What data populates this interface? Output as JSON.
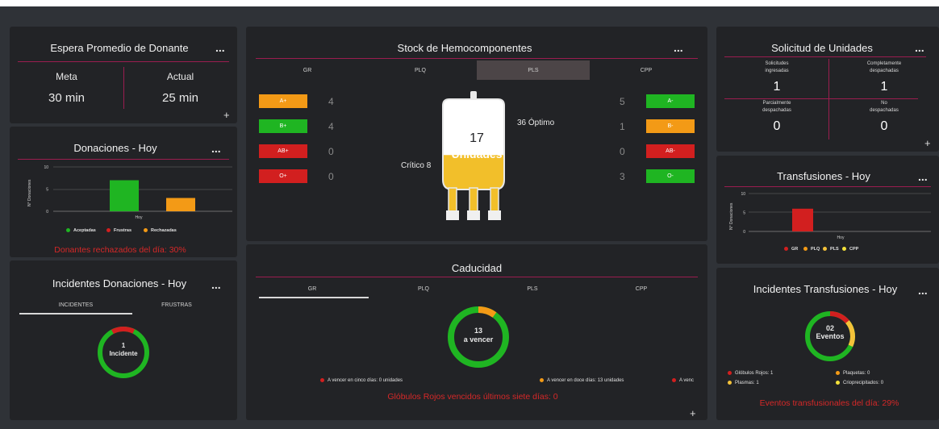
{
  "colors": {
    "green": "#1fb522",
    "orange": "#f39a16",
    "red": "#d21f1f",
    "yellow": "#f4c23a",
    "accent_line": "#9b1d4f",
    "card_bg": "#222326",
    "page_bg": "#2f3237"
  },
  "espera": {
    "title": "Espera Promedio de Donante",
    "menu": "...",
    "meta_label": "Meta",
    "meta_value": "30 min",
    "actual_label": "Actual",
    "actual_value": "25 min",
    "plus": "+"
  },
  "donaciones": {
    "title": "Donaciones - Hoy",
    "menu": "...",
    "ylabel": "N° Donaciones",
    "xlabel": "Hoy",
    "yticks": [
      "10",
      "5",
      "0"
    ],
    "legend": [
      {
        "label": "Aceptadas",
        "color": "#1fb522"
      },
      {
        "label": "Frustras",
        "color": "#d21f1f"
      },
      {
        "label": "Rechazadas",
        "color": "#f39a16"
      }
    ],
    "note": "Donantes rechazados del día: 30%"
  },
  "chart_data": [
    {
      "type": "bar",
      "xlabel": "Hoy",
      "ylabel": "N° Donaciones",
      "ylim": [
        0,
        10
      ],
      "categories": [
        "Hoy"
      ],
      "series": [
        {
          "name": "Aceptadas",
          "values": [
            7
          ]
        },
        {
          "name": "Frustras",
          "values": [
            0
          ]
        },
        {
          "name": "Rechazadas",
          "values": [
            3
          ]
        }
      ]
    },
    {
      "type": "bar",
      "xlabel": "Hoy",
      "ylabel": "N° Donaciones",
      "ylim": [
        0,
        10
      ],
      "categories": [
        "Hoy"
      ],
      "series": [
        {
          "name": "GR",
          "values": [
            6
          ]
        },
        {
          "name": "PLQ",
          "values": [
            0
          ]
        },
        {
          "name": "PLS",
          "values": [
            0
          ]
        },
        {
          "name": "CPP",
          "values": [
            0
          ]
        }
      ]
    },
    {
      "type": "pie",
      "series": [
        {
          "name": "Rechazos",
          "values": [
            0.15
          ]
        },
        {
          "name": "Resto",
          "values": [
            0.85
          ]
        }
      ]
    },
    {
      "type": "pie",
      "series": [
        {
          "name": "A vencer en doce días",
          "values": [
            13
          ]
        },
        {
          "name": "Resto",
          "values": [
            0.1
          ]
        }
      ]
    },
    {
      "type": "pie",
      "series": [
        {
          "name": "Glóbulos Rojos",
          "values": [
            1
          ]
        },
        {
          "name": "Plasmas",
          "values": [
            1
          ]
        }
      ]
    }
  ],
  "incidentes_donaciones": {
    "title": "Incidentes Donaciones - Hoy",
    "menu": "...",
    "tabs": [
      "INCIDENTES",
      "FRUSTRAS"
    ],
    "donut_number": "1",
    "donut_label": "Incidente",
    "ring": {
      "red_fraction": 0.15
    }
  },
  "stock": {
    "title": "Stock de Hemocomponentes",
    "menu": "...",
    "tabs": [
      "GR",
      "PLQ",
      "PLS",
      "CPP"
    ],
    "active_tab": "PLS",
    "left": [
      {
        "label": "A+",
        "count": "4",
        "color": "#f39a16"
      },
      {
        "label": "B+",
        "count": "4",
        "color": "#1fb522"
      },
      {
        "label": "AB+",
        "count": "0",
        "color": "#d21f1f"
      },
      {
        "label": "O+",
        "count": "0",
        "color": "#d21f1f"
      }
    ],
    "right": [
      {
        "label": "A-",
        "count": "5",
        "color": "#1fb522"
      },
      {
        "label": "B-",
        "count": "1",
        "color": "#f39a16"
      },
      {
        "label": "AB-",
        "count": "0",
        "color": "#d21f1f"
      },
      {
        "label": "O-",
        "count": "3",
        "color": "#1fb522"
      }
    ],
    "bag_number": "17",
    "bag_label": "Unidades",
    "optimo_value": "36",
    "optimo_label": "Óptimo",
    "critico_label": "Crítico",
    "critico_value": "8",
    "fill_level": 0.38
  },
  "caducidad": {
    "title": "Caducidad",
    "tabs": [
      "GR",
      "PLQ",
      "PLS",
      "CPP"
    ],
    "donut_number": "13",
    "donut_label": "a vencer",
    "legend": [
      {
        "label": "A vencer en cinco días: 0 unidades",
        "color": "#d21f1f"
      },
      {
        "label": "A vencer en doce días: 13 unidades",
        "color": "#f39a16"
      },
      {
        "label": "A venc",
        "color": "#d21f1f"
      }
    ],
    "note": "Glóbulos Rojos vencidos últimos siete días: 0",
    "plus": "+"
  },
  "solicitud": {
    "title": "Solicitud de Unidades",
    "menu": "...",
    "cells": [
      {
        "line1": "Solicitudes",
        "line2": "ingresadas",
        "value": "1"
      },
      {
        "line1": "Completamente",
        "line2": "despachadas",
        "value": "1"
      },
      {
        "line1": "Parcialmente",
        "line2": "despachadas",
        "value": "0"
      },
      {
        "line1": "No",
        "line2": "despachadas",
        "value": "0"
      }
    ],
    "plus": "+"
  },
  "transfusiones": {
    "title": "Transfusiones - Hoy",
    "menu": "...",
    "ylabel": "N° Donaciones",
    "xlabel": "Hoy",
    "yticks": [
      "10",
      "5",
      "0"
    ],
    "legend": [
      {
        "label": "GR",
        "color": "#d21f1f"
      },
      {
        "label": "PLQ",
        "color": "#f39a16"
      },
      {
        "label": "PLS",
        "color": "#f4c23a"
      },
      {
        "label": "CPP",
        "color": "#f4e23a"
      }
    ]
  },
  "incidentes_transfusiones": {
    "title": "Incidentes Transfusiones - Hoy",
    "menu": "...",
    "donut_number": "02",
    "donut_label": "Eventos",
    "legend": [
      {
        "label": "Glóbulos Rojos: 1",
        "color": "#d21f1f"
      },
      {
        "label": "Plaquetas: 0",
        "color": "#f39a16"
      },
      {
        "label": "Plasmas: 1",
        "color": "#f4c23a"
      },
      {
        "label": "Crioprecipitados: 0",
        "color": "#f4e23a"
      }
    ],
    "note": "Eventos transfusionales del día: 29%"
  }
}
